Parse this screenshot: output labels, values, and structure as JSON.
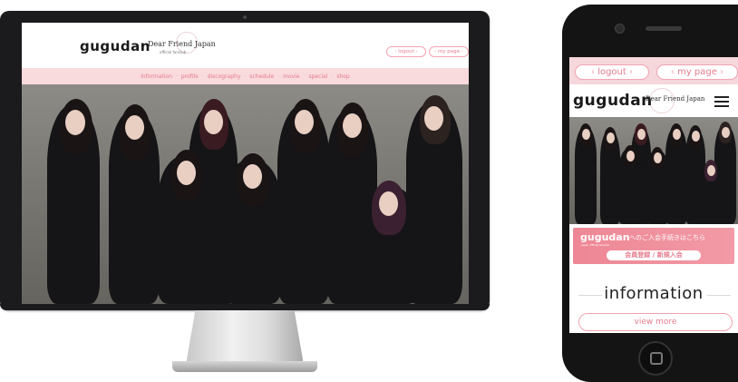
{
  "desktop": {
    "logo": "gugudan",
    "logo_sub": "Dear Friend Japan",
    "logo_tag": "official fanclub",
    "logout_label": "logout",
    "mypage_label": "my page",
    "nav": [
      "information",
      "profile",
      "discography",
      "schedule",
      "movie",
      "special",
      "shop"
    ]
  },
  "mobile": {
    "logout_label": "logout",
    "mypage_label": "my page",
    "logo": "gugudan",
    "logo_sub": "Dear Friend Japan",
    "banner": {
      "logo": "gugudan",
      "sub": "japan official fanclub",
      "text": "へのご入会手続きはこちら",
      "button": "会員登録 / 新規入会"
    },
    "info_title": "information",
    "view_more_label": "view more"
  },
  "colors": {
    "accent_pink": "#e57c8e",
    "nav_bg": "#f9dadd",
    "banner_pink": "#ee8795"
  }
}
